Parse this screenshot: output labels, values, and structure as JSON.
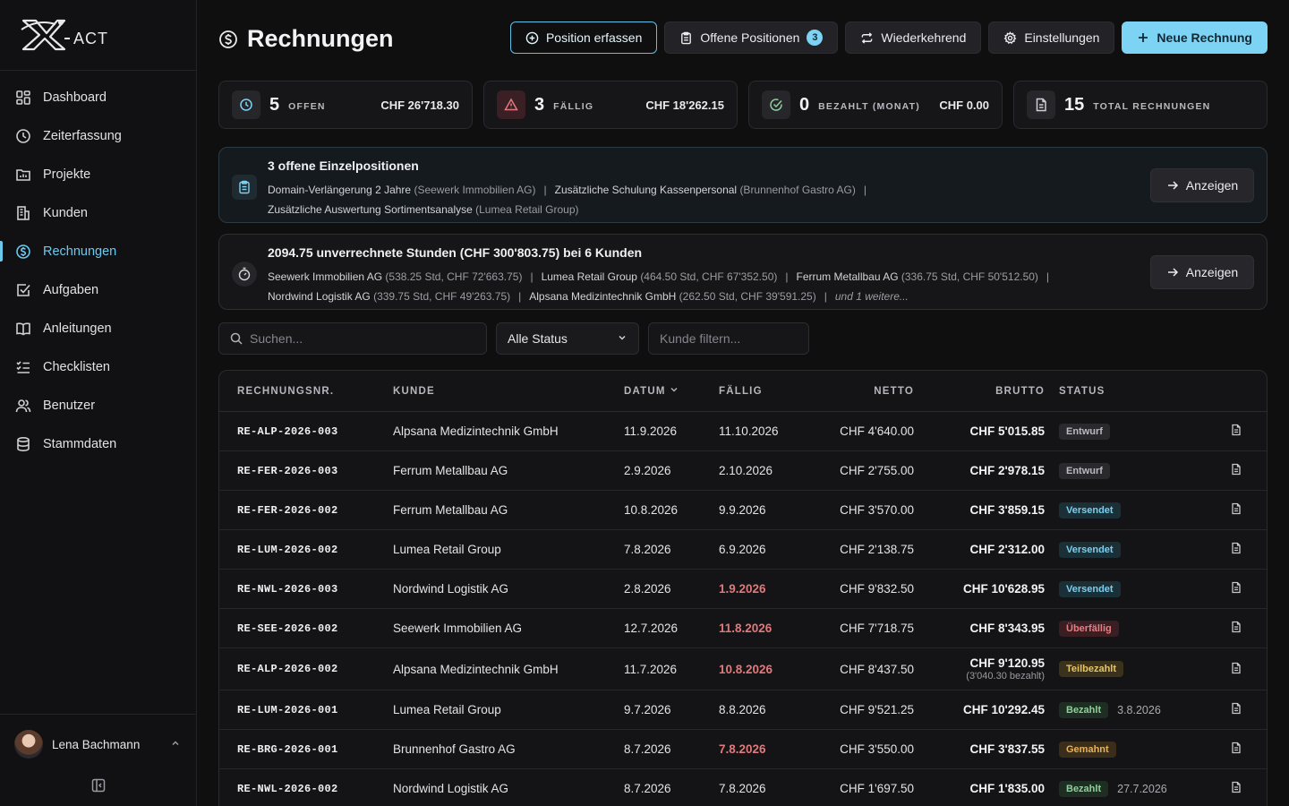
{
  "app": {
    "logo_text": "X-ACT"
  },
  "sidebar": {
    "items": [
      {
        "label": "Dashboard",
        "icon": "dashboard-icon"
      },
      {
        "label": "Zeiterfassung",
        "icon": "clock-icon"
      },
      {
        "label": "Projekte",
        "icon": "folder-chart-icon"
      },
      {
        "label": "Kunden",
        "icon": "building-icon"
      },
      {
        "label": "Rechnungen",
        "icon": "dollar-circle-icon",
        "active": true
      },
      {
        "label": "Aufgaben",
        "icon": "checkbox-icon"
      },
      {
        "label": "Anleitungen",
        "icon": "book-icon"
      },
      {
        "label": "Checklisten",
        "icon": "list-checks-icon"
      },
      {
        "label": "Benutzer",
        "icon": "users-icon"
      },
      {
        "label": "Stammdaten",
        "icon": "database-icon"
      }
    ],
    "user": {
      "name": "Lena Bachmann"
    }
  },
  "header": {
    "title": "Rechnungen",
    "buttons": {
      "position": "Position erfassen",
      "offene": "Offene Positionen",
      "offene_count": "3",
      "wiederkehrend": "Wiederkehrend",
      "einstellungen": "Einstellungen",
      "neue": "Neue Rechnung"
    }
  },
  "stats": [
    {
      "num": "5",
      "label": "OFFEN",
      "amount": "CHF 26'718.30"
    },
    {
      "num": "3",
      "label": "FÄLLIG",
      "amount": "CHF 18'262.15"
    },
    {
      "num": "0",
      "label": "BEZAHLT (MONAT)",
      "amount": "CHF 0.00"
    },
    {
      "num": "15",
      "label": "TOTAL RECHNUNGEN",
      "amount": ""
    }
  ],
  "banner_positions": {
    "title": "3 offene Einzelpositionen",
    "button": "Anzeigen",
    "items": [
      {
        "name": "Domain-Verlängerung 2 Jahre",
        "client": "(Seewerk Immobilien AG)"
      },
      {
        "name": "Zusätzliche Schulung Kassenpersonal",
        "client": "(Brunnenhof Gastro AG)"
      },
      {
        "name": "Zusätzliche Auswertung Sortimentsanalyse",
        "client": "(Lumea Retail Group)"
      }
    ]
  },
  "banner_hours": {
    "title": "2094.75 unverrechnete Stunden (CHF 300'803.75) bei 6 Kunden",
    "button": "Anzeigen",
    "items": [
      {
        "name": "Seewerk Immobilien AG",
        "detail": "(538.25 Std, CHF 72'663.75)"
      },
      {
        "name": "Lumea Retail Group",
        "detail": "(464.50 Std, CHF 67'352.50)"
      },
      {
        "name": "Ferrum Metallbau AG",
        "detail": "(336.75 Std, CHF 50'512.50)"
      },
      {
        "name": "Nordwind Logistik AG",
        "detail": "(339.75 Std, CHF 49'263.75)"
      },
      {
        "name": "Alpsana Medizintechnik GmbH",
        "detail": "(262.50 Std, CHF 39'591.25)"
      }
    ],
    "more": "und 1 weitere..."
  },
  "filters": {
    "search_placeholder": "Suchen...",
    "status_value": "Alle Status",
    "kunde_placeholder": "Kunde filtern..."
  },
  "table": {
    "columns": [
      "RECHNUNGSNR.",
      "KUNDE",
      "DATUM",
      "FÄLLIG",
      "NETTO",
      "BRUTTO",
      "STATUS"
    ],
    "rows": [
      {
        "nr": "RE-ALP-2026-003",
        "kunde": "Alpsana Medizintechnik GmbH",
        "datum": "11.9.2026",
        "faellig": "11.10.2026",
        "overdue": false,
        "netto": "CHF 4'640.00",
        "brutto": "CHF 5'015.85",
        "note": "",
        "status": "Entwurf",
        "status_key": "Entwurf",
        "paydate": ""
      },
      {
        "nr": "RE-FER-2026-003",
        "kunde": "Ferrum Metallbau AG",
        "datum": "2.9.2026",
        "faellig": "2.10.2026",
        "overdue": false,
        "netto": "CHF 2'755.00",
        "brutto": "CHF 2'978.15",
        "note": "",
        "status": "Entwurf",
        "status_key": "Entwurf",
        "paydate": ""
      },
      {
        "nr": "RE-FER-2026-002",
        "kunde": "Ferrum Metallbau AG",
        "datum": "10.8.2026",
        "faellig": "9.9.2026",
        "overdue": false,
        "netto": "CHF 3'570.00",
        "brutto": "CHF 3'859.15",
        "note": "",
        "status": "Versendet",
        "status_key": "Versendet",
        "paydate": ""
      },
      {
        "nr": "RE-LUM-2026-002",
        "kunde": "Lumea Retail Group",
        "datum": "7.8.2026",
        "faellig": "6.9.2026",
        "overdue": false,
        "netto": "CHF 2'138.75",
        "brutto": "CHF 2'312.00",
        "note": "",
        "status": "Versendet",
        "status_key": "Versendet",
        "paydate": ""
      },
      {
        "nr": "RE-NWL-2026-003",
        "kunde": "Nordwind Logistik AG",
        "datum": "2.8.2026",
        "faellig": "1.9.2026",
        "overdue": true,
        "netto": "CHF 9'832.50",
        "brutto": "CHF 10'628.95",
        "note": "",
        "status": "Versendet",
        "status_key": "Versendet",
        "paydate": ""
      },
      {
        "nr": "RE-SEE-2026-002",
        "kunde": "Seewerk Immobilien AG",
        "datum": "12.7.2026",
        "faellig": "11.8.2026",
        "overdue": true,
        "netto": "CHF 7'718.75",
        "brutto": "CHF 8'343.95",
        "note": "",
        "status": "Überfällig",
        "status_key": "Ueberfaellig",
        "paydate": ""
      },
      {
        "nr": "RE-ALP-2026-002",
        "kunde": "Alpsana Medizintechnik GmbH",
        "datum": "11.7.2026",
        "faellig": "10.8.2026",
        "overdue": true,
        "netto": "CHF 8'437.50",
        "brutto": "CHF 9'120.95",
        "note": "(3'040.30 bezahlt)",
        "status": "Teilbezahlt",
        "status_key": "Teilbezahlt",
        "paydate": ""
      },
      {
        "nr": "RE-LUM-2026-001",
        "kunde": "Lumea Retail Group",
        "datum": "9.7.2026",
        "faellig": "8.8.2026",
        "overdue": false,
        "netto": "CHF 9'521.25",
        "brutto": "CHF 10'292.45",
        "note": "",
        "status": "Bezahlt",
        "status_key": "Bezahlt",
        "paydate": "3.8.2026"
      },
      {
        "nr": "RE-BRG-2026-001",
        "kunde": "Brunnenhof Gastro AG",
        "datum": "8.7.2026",
        "faellig": "7.8.2026",
        "overdue": true,
        "netto": "CHF 3'550.00",
        "brutto": "CHF 3'837.55",
        "note": "",
        "status": "Gemahnt",
        "status_key": "Gemahnt",
        "paydate": ""
      },
      {
        "nr": "RE-NWL-2026-002",
        "kunde": "Nordwind Logistik AG",
        "datum": "8.7.2026",
        "faellig": "7.8.2026",
        "overdue": false,
        "netto": "CHF 1'697.50",
        "brutto": "CHF 1'835.00",
        "note": "",
        "status": "Bezahlt",
        "status_key": "Bezahlt",
        "paydate": "27.7.2026"
      }
    ]
  },
  "colors": {
    "accent": "#7dd3f4",
    "overdue": "#e0797c",
    "background": "#0f0f10"
  }
}
